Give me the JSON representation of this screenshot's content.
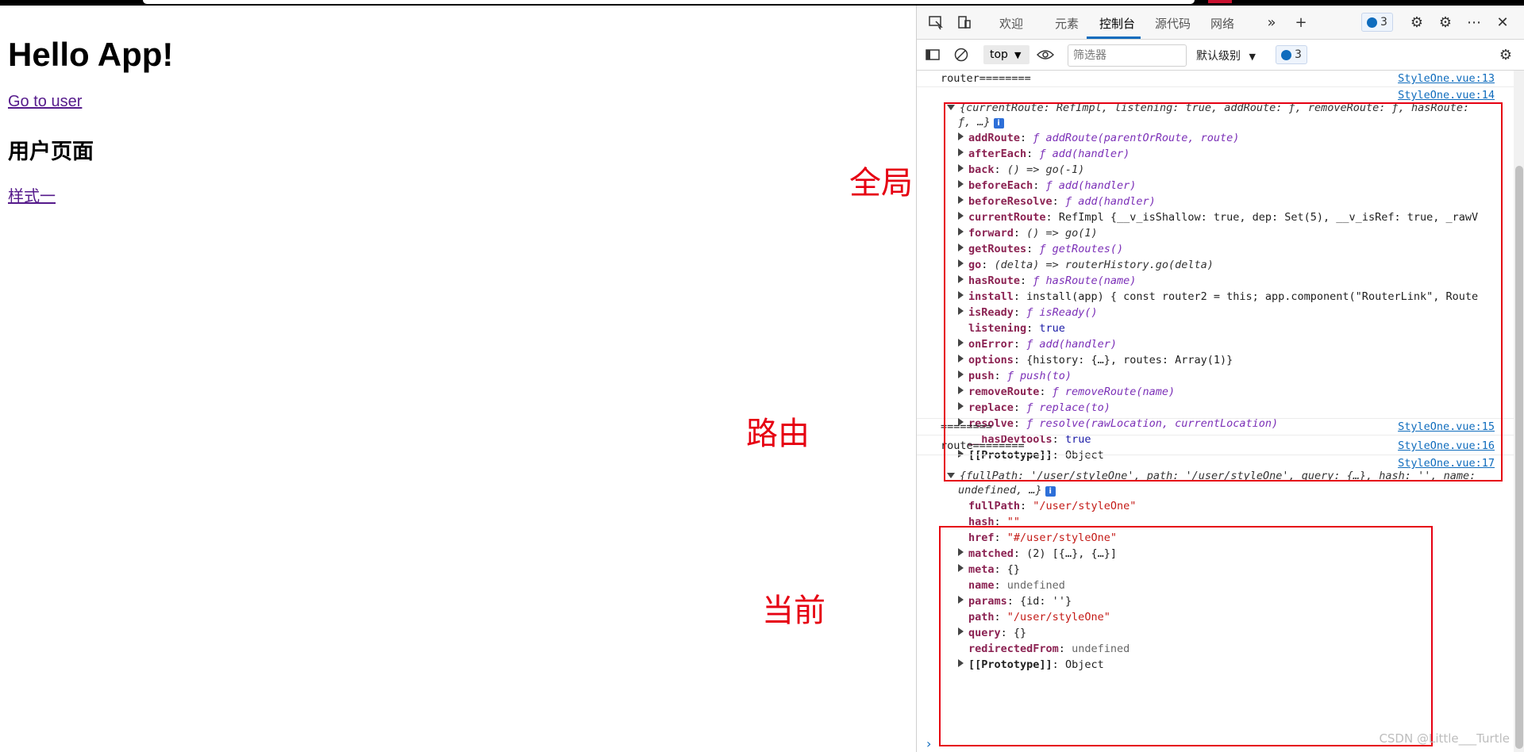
{
  "page": {
    "title": "Hello App!",
    "link_user": "Go to user",
    "heading": "用户页面",
    "link_style": "样式一"
  },
  "annotations": {
    "global": "全局",
    "router": "路由",
    "current": "当前"
  },
  "devtools": {
    "tabs": [
      "欢迎",
      "元素",
      "控制台",
      "源代码",
      "网络"
    ],
    "active_tab": "控制台",
    "issues_count": "3",
    "toolbar": {
      "context": "top",
      "filter_placeholder": "筛选器",
      "level": "默认级别",
      "issues_count": "3"
    },
    "messages": {
      "router_label": "router========",
      "src13": "StyleOne.vue:13",
      "src14": "StyleOne.vue:14",
      "sep": "========",
      "src15": "StyleOne.vue:15",
      "route_label": "route========",
      "src16": "StyleOne.vue:16",
      "src17": "StyleOne.vue:17"
    },
    "router_object": {
      "summary_1": "{currentRoute: RefImpl, listening: true, addRoute: ƒ, removeRoute: ƒ, hasRoute:",
      "summary_2": "ƒ, …}",
      "props": [
        {
          "key": "addRoute",
          "value": "ƒ addRoute(parentOrRoute, route)"
        },
        {
          "key": "afterEach",
          "value": "ƒ add(handler)"
        },
        {
          "key": "back",
          "value": "() => go(-1)"
        },
        {
          "key": "beforeEach",
          "value": "ƒ add(handler)"
        },
        {
          "key": "beforeResolve",
          "value": "ƒ add(handler)"
        },
        {
          "key": "currentRoute",
          "value": "RefImpl {__v_isShallow: true, dep: Set(5), __v_isRef: true, _rawV"
        },
        {
          "key": "forward",
          "value": "() => go(1)"
        },
        {
          "key": "getRoutes",
          "value": "ƒ getRoutes()"
        },
        {
          "key": "go",
          "value": "(delta) => routerHistory.go(delta)"
        },
        {
          "key": "hasRoute",
          "value": "ƒ hasRoute(name)"
        },
        {
          "key": "install",
          "value": "install(app) { const router2 = this; app.component(\"RouterLink\", Route"
        },
        {
          "key": "isReady",
          "value": "ƒ isReady()"
        },
        {
          "key": "listening",
          "value": "true"
        },
        {
          "key": "onError",
          "value": "ƒ add(handler)"
        },
        {
          "key": "options",
          "value": "{history: {…}, routes: Array(1)}"
        },
        {
          "key": "push",
          "value": "ƒ push(to)"
        },
        {
          "key": "removeRoute",
          "value": "ƒ removeRoute(name)"
        },
        {
          "key": "replace",
          "value": "ƒ replace(to)"
        },
        {
          "key": "resolve",
          "value": "ƒ resolve(rawLocation, currentLocation)"
        },
        {
          "key": "__hasDevtools",
          "value": "true"
        },
        {
          "key": "[[Prototype]]",
          "value": "Object"
        }
      ]
    },
    "route_object": {
      "summary_1": "{fullPath: '/user/styleOne', path: '/user/styleOne', query: {…}, hash: '', name:",
      "summary_2": "undefined, …}",
      "props": [
        {
          "key": "fullPath",
          "value": "\"/user/styleOne\""
        },
        {
          "key": "hash",
          "value": "\"\""
        },
        {
          "key": "href",
          "value": "\"#/user/styleOne\""
        },
        {
          "key": "matched",
          "value": "(2) [{…}, {…}]"
        },
        {
          "key": "meta",
          "value": "{}"
        },
        {
          "key": "name",
          "value": "undefined"
        },
        {
          "key": "params",
          "value": "{id: ''}"
        },
        {
          "key": "path",
          "value": "\"/user/styleOne\""
        },
        {
          "key": "query",
          "value": "{}"
        },
        {
          "key": "redirectedFrom",
          "value": "undefined"
        },
        {
          "key": "[[Prototype]]",
          "value": "Object"
        }
      ]
    }
  },
  "watermark": "CSDN @Little___Turtle"
}
